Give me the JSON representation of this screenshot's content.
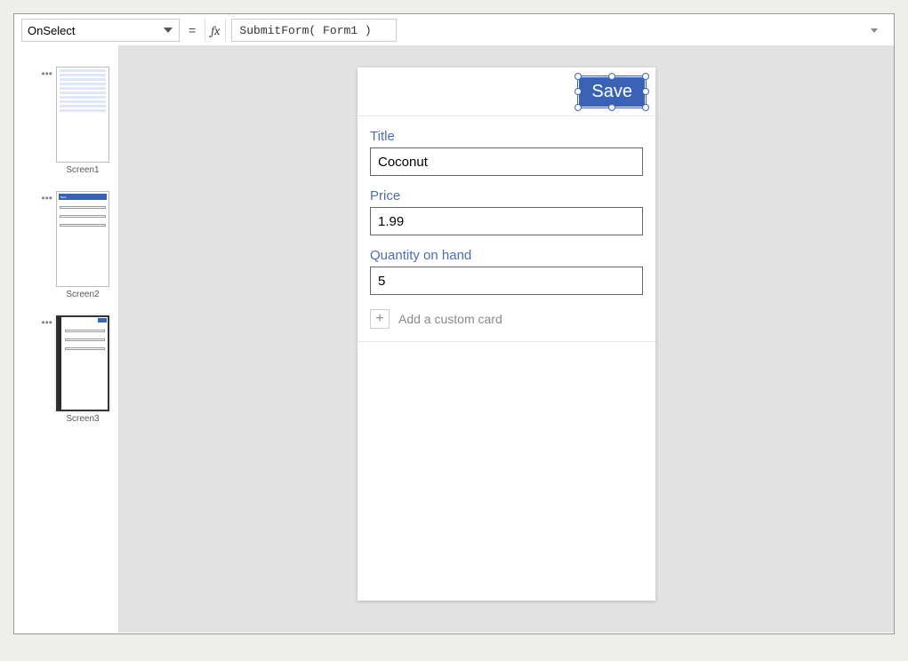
{
  "formula_bar": {
    "property": "OnSelect",
    "equals": "=",
    "fx": "fx",
    "formula": "SubmitForm( Form1 )"
  },
  "thumbnails": {
    "items": [
      {
        "label": "Screen1"
      },
      {
        "label": "Screen2"
      },
      {
        "label": "Screen3"
      }
    ],
    "t2_header": "Back"
  },
  "device": {
    "save_label": "Save",
    "fields": [
      {
        "label": "Title",
        "value": "Coconut"
      },
      {
        "label": "Price",
        "value": "1.99"
      },
      {
        "label": "Quantity on hand",
        "value": "5"
      }
    ],
    "add_card_label": "Add a custom card",
    "plus_glyph": "+"
  }
}
